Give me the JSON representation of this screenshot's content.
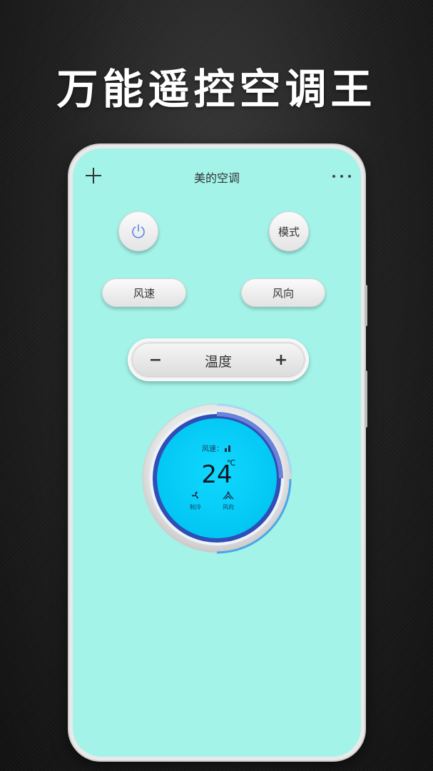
{
  "headline": "万能遥控空调王",
  "app": {
    "title": "美的空调"
  },
  "controls": {
    "mode_label": "模式",
    "fan_speed_label": "风速",
    "direction_label": "风向",
    "temp_label": "温度",
    "minus": "−",
    "plus": "+"
  },
  "display": {
    "speed_label": "风速：",
    "temperature": "24",
    "unit": "℃",
    "mode_label": "制冷",
    "direction_label": "风向"
  },
  "colors": {
    "screen_bg": "#a3f3e8",
    "display_bg": "#00cff8",
    "ring": "#2e4fb8",
    "accent": "#4a8ce0"
  },
  "icons": {
    "add": "plus-icon",
    "more": "more-icon",
    "power": "power-icon",
    "signal": "signal-icon",
    "mode": "fan-icon",
    "direction": "wind-direction-icon"
  }
}
